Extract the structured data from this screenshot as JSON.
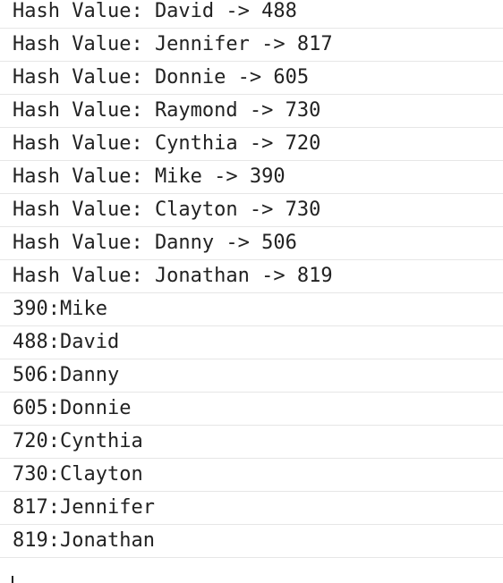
{
  "console": {
    "lines": [
      "Hash Value: David -> 488",
      "Hash Value: Jennifer -> 817",
      "Hash Value: Donnie -> 605",
      "Hash Value: Raymond -> 730",
      "Hash Value: Cynthia -> 720",
      "Hash Value: Mike -> 390",
      "Hash Value: Clayton -> 730",
      "Hash Value: Danny -> 506",
      "Hash Value: Jonathan -> 819",
      "390:Mike",
      "488:David",
      "506:Danny",
      "605:Donnie",
      "720:Cynthia",
      "730:Clayton",
      "817:Jennifer",
      "819:Jonathan"
    ]
  }
}
